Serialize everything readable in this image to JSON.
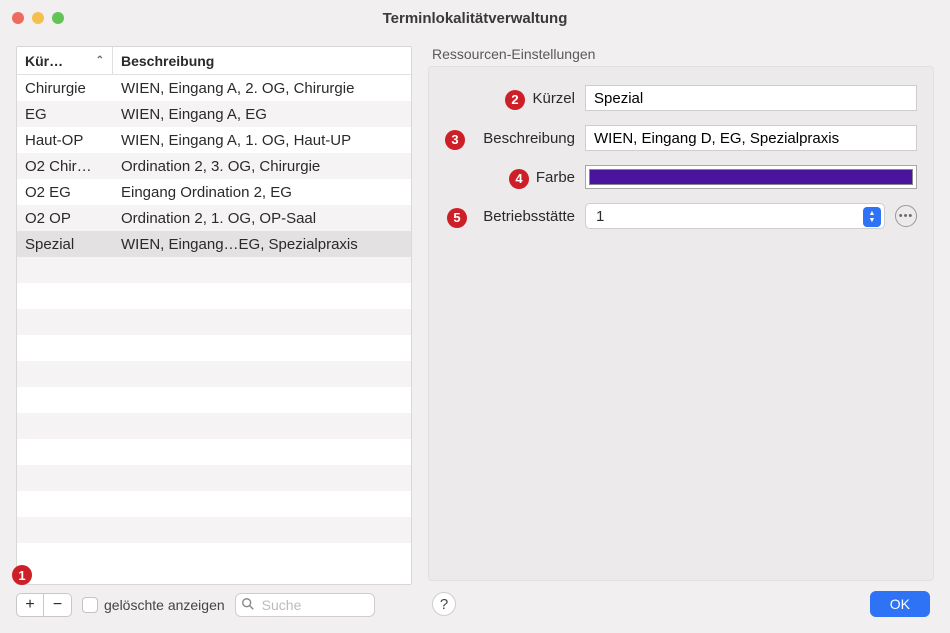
{
  "window": {
    "title": "Terminlokalitätverwaltung"
  },
  "table": {
    "col_kurz": "Kür…",
    "col_besch": "Beschreibung",
    "rows": [
      {
        "kurz": "Chirurgie",
        "besch": "WIEN, Eingang A, 2. OG, Chirurgie",
        "selected": false
      },
      {
        "kurz": "EG",
        "besch": "WIEN, Eingang A, EG",
        "selected": false
      },
      {
        "kurz": "Haut-OP",
        "besch": "WIEN, Eingang A, 1. OG, Haut-UP",
        "selected": false
      },
      {
        "kurz": "O2 Chir…",
        "besch": "Ordination 2, 3. OG, Chirurgie",
        "selected": false
      },
      {
        "kurz": "O2 EG",
        "besch": "Eingang Ordination 2, EG",
        "selected": false
      },
      {
        "kurz": "O2 OP",
        "besch": "Ordination 2, 1. OG, OP-Saal",
        "selected": false
      },
      {
        "kurz": "Spezial",
        "besch": "WIEN, Eingang…EG, Spezialpraxis",
        "selected": true
      }
    ]
  },
  "footer": {
    "add": "+",
    "remove": "−",
    "show_deleted": "gelöschte anzeigen",
    "search_placeholder": "Suche"
  },
  "settings": {
    "section_title": "Ressourcen-Einstellungen",
    "kurz_label": "Kürzel",
    "kurz_value": "Spezial",
    "besch_label": "Beschreibung",
    "besch_value": "WIEN, Eingang D, EG, Spezialpraxis",
    "farbe_label": "Farbe",
    "farbe_hex": "#4a159c",
    "betrieb_label": "Betriebsstätte",
    "betrieb_value": "1"
  },
  "buttons": {
    "help": "?",
    "ok": "OK"
  },
  "annotations": {
    "a1": "1",
    "a2": "2",
    "a3": "3",
    "a4": "4",
    "a5": "5"
  }
}
